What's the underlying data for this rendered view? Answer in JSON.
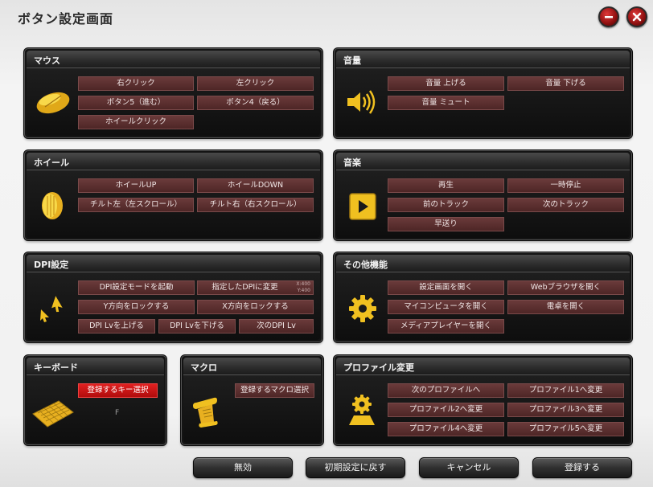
{
  "window": {
    "title": "ボタン設定画面"
  },
  "panels": {
    "mouse": {
      "title": "マウス",
      "buttons": [
        "右クリック",
        "左クリック",
        "ボタン5（進む）",
        "ボタン4（戻る）",
        "ホイールクリック"
      ]
    },
    "volume": {
      "title": "音量",
      "buttons": [
        "音量 上げる",
        "音量 下げる",
        "音量 ミュート"
      ]
    },
    "wheel": {
      "title": "ホイール",
      "buttons": [
        "ホイールUP",
        "ホイールDOWN",
        "チルト左（左スクロール）",
        "チルト右（右スクロール）"
      ]
    },
    "music": {
      "title": "音楽",
      "buttons": [
        "再生",
        "一時停止",
        "前のトラック",
        "次のトラック",
        "早送り"
      ]
    },
    "dpi": {
      "title": "DPI設定",
      "buttons": [
        "DPI設定モードを起動",
        "指定したDPIに変更",
        "Y方向をロックする",
        "X方向をロックする",
        "DPI Lvを上げる",
        "DPI Lvを下げる",
        "次のDPI Lv"
      ],
      "dpi_small": [
        "X:400",
        "Y:400"
      ]
    },
    "other": {
      "title": "その他機能",
      "buttons": [
        "設定画面を開く",
        "Webブラウザを開く",
        "マイコンピュータを開く",
        "電卓を開く",
        "メディアプレイヤーを開く"
      ]
    },
    "keyboard": {
      "title": "キーボード",
      "button": "登録するキー選択",
      "assigned": "F"
    },
    "macro": {
      "title": "マクロ",
      "button": "登録するマクロ選択"
    },
    "profile": {
      "title": "プロファイル変更",
      "buttons": [
        "次のプロファイルへ",
        "プロファイル1へ変更",
        "プロファイル2へ変更",
        "プロファイル3へ変更",
        "プロファイル4へ変更",
        "プロファイル5へ変更"
      ]
    }
  },
  "footer": {
    "disable": "無効",
    "reset": "初期設定に戻す",
    "cancel": "キャンセル",
    "register": "登録する"
  },
  "colors": {
    "accent_red": "#b00c0c",
    "icon_gold": "#f0c020",
    "button_maroon": "#5a2e2e"
  }
}
